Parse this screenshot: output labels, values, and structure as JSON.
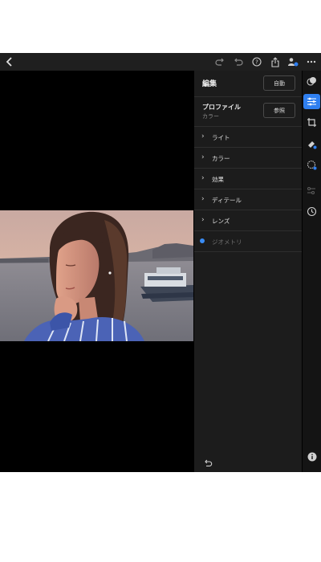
{
  "topbar": {
    "icons": [
      "back-icon",
      "redo-icon",
      "undo-icon",
      "help-icon",
      "share-icon",
      "people-icon",
      "more-icon"
    ]
  },
  "panel": {
    "title": "編集",
    "auto_label": "自動",
    "profile": {
      "label": "プロファイル",
      "value": "カラー",
      "browse_label": "参照"
    },
    "sections": [
      {
        "label": "ライト"
      },
      {
        "label": "カラー"
      },
      {
        "label": "効果"
      },
      {
        "label": "ディテール"
      },
      {
        "label": "レンズ"
      },
      {
        "label": "ジオメトリ"
      }
    ]
  },
  "toolbar": {
    "tools": [
      "presets-icon",
      "edit-sliders-icon",
      "crop-icon",
      "healing-icon",
      "masking-icon",
      "versions-icon",
      "history-icon"
    ],
    "active": "edit-sliders-icon",
    "info_icon": "info-icon"
  },
  "colors": {
    "accent": "#2f7ff0",
    "panel_bg": "#1c1c1c",
    "toolbar_bg": "#141414",
    "topbar_bg": "#1f1f1f"
  }
}
